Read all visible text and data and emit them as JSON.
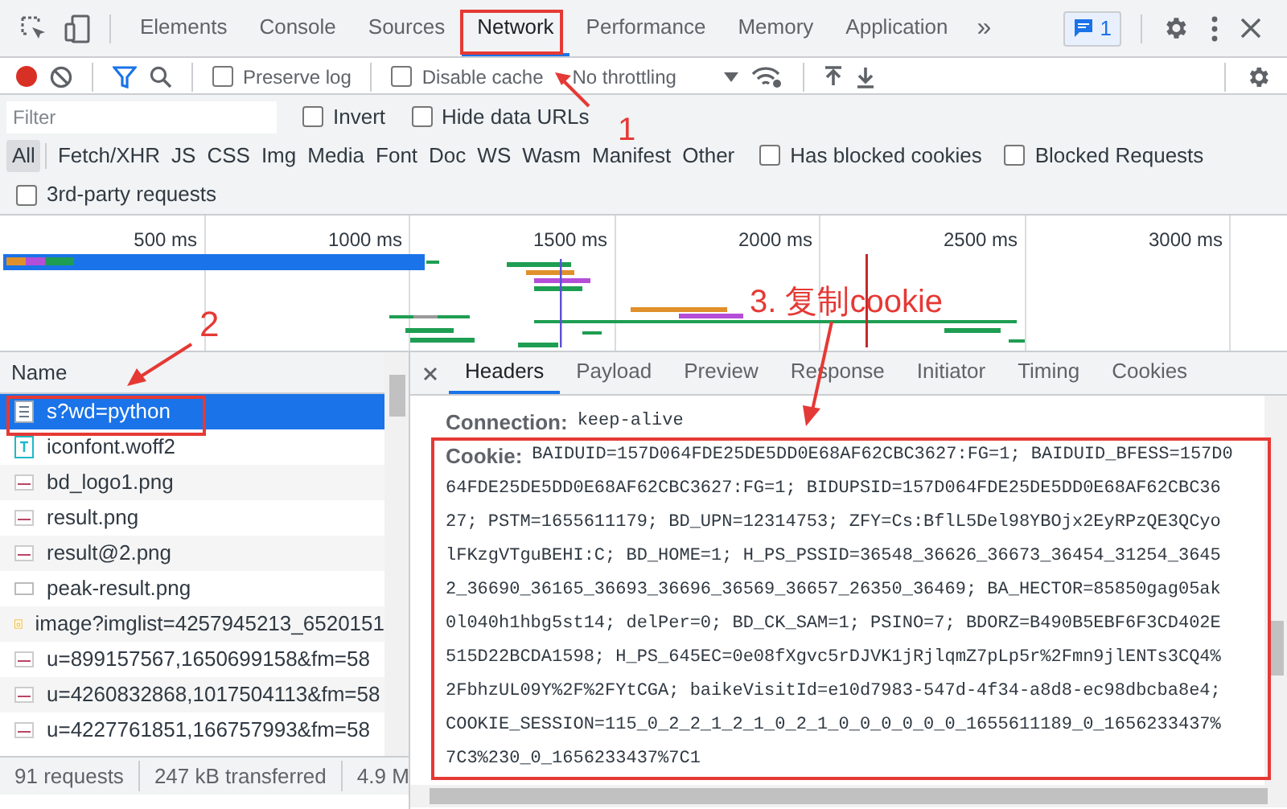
{
  "top_tabs": [
    {
      "label": "Elements",
      "selected": false
    },
    {
      "label": "Console",
      "selected": false
    },
    {
      "label": "Sources",
      "selected": false
    },
    {
      "label": "Network",
      "selected": true
    },
    {
      "label": "Performance",
      "selected": false
    },
    {
      "label": "Memory",
      "selected": false
    },
    {
      "label": "Application",
      "selected": false
    }
  ],
  "more_tabs": "»",
  "message_count": "1",
  "toolbar": {
    "recording": true,
    "checkboxes": [
      {
        "label": "Preserve log",
        "checked": false
      },
      {
        "label": "Disable cache",
        "checked": false
      }
    ],
    "throttling": "No throttling"
  },
  "filter": {
    "placeholder": "Filter",
    "checkboxes": [
      {
        "label": "Invert",
        "checked": false
      },
      {
        "label": "Hide data URLs",
        "checked": false
      }
    ]
  },
  "type_filters": [
    {
      "label": "All",
      "selected": true
    },
    {
      "label": "Fetch/XHR",
      "selected": false
    },
    {
      "label": "JS",
      "selected": false
    },
    {
      "label": "CSS",
      "selected": false
    },
    {
      "label": "Img",
      "selected": false
    },
    {
      "label": "Media",
      "selected": false
    },
    {
      "label": "Font",
      "selected": false
    },
    {
      "label": "Doc",
      "selected": false
    },
    {
      "label": "WS",
      "selected": false
    },
    {
      "label": "Wasm",
      "selected": false
    },
    {
      "label": "Manifest",
      "selected": false
    },
    {
      "label": "Other",
      "selected": false
    }
  ],
  "extra_checkboxes": [
    {
      "label": "Has blocked cookies",
      "checked": false
    },
    {
      "label": "Blocked Requests",
      "checked": false
    },
    {
      "label": "3rd-party requests",
      "checked": false
    }
  ],
  "timeline": {
    "ticks": [
      "500 ms",
      "1000 ms",
      "1500 ms",
      "2000 ms",
      "2500 ms",
      "3000 ms"
    ]
  },
  "requests": {
    "column": "Name",
    "rows": [
      {
        "name": "s?wd=python",
        "kind": "document",
        "selected": true
      },
      {
        "name": "iconfont.woff2",
        "kind": "font",
        "selected": false
      },
      {
        "name": "bd_logo1.png",
        "kind": "image",
        "selected": false
      },
      {
        "name": "result.png",
        "kind": "image",
        "selected": false
      },
      {
        "name": "result@2.png",
        "kind": "image",
        "selected": false
      },
      {
        "name": "peak-result.png",
        "kind": "blank",
        "selected": false
      },
      {
        "name": "image?imglist=4257945213_6520151",
        "kind": "script",
        "selected": false
      },
      {
        "name": "u=899157567,1650699158&fm=58",
        "kind": "image",
        "selected": false
      },
      {
        "name": "u=4260832868,1017504113&fm=58",
        "kind": "image",
        "selected": false
      },
      {
        "name": "u=4227761851,166757993&fm=58",
        "kind": "image",
        "selected": false
      }
    ]
  },
  "status_bar": [
    "91 requests",
    "247 kB transferred",
    "4.9 M"
  ],
  "detail_tabs": [
    {
      "label": "Headers",
      "selected": true
    },
    {
      "label": "Payload",
      "selected": false
    },
    {
      "label": "Preview",
      "selected": false
    },
    {
      "label": "Response",
      "selected": false
    },
    {
      "label": "Initiator",
      "selected": false
    },
    {
      "label": "Timing",
      "selected": false
    },
    {
      "label": "Cookies",
      "selected": false
    }
  ],
  "headers": [
    {
      "name": "Connection:",
      "lines": [
        "keep-alive"
      ]
    },
    {
      "name": "Cookie:",
      "lines": [
        "BAIDUID=157D064FDE25DE5DD0E68AF62CBC3627:FG=1; BAIDUID_BFESS=157D0",
        "64FDE25DE5DD0E68AF62CBC3627:FG=1; BIDUPSID=157D064FDE25DE5DD0E68AF62CBC36",
        "27; PSTM=1655611179; BD_UPN=12314753; ZFY=Cs:BflL5Del98YBOjx2EyRPzQE3QCyo",
        "lFKzgVTguBEHI:C; BD_HOME=1; H_PS_PSSID=36548_36626_36673_36454_31254_3645",
        "2_36690_36165_36693_36696_36569_36657_26350_36469; BA_HECTOR=85850gag05ak",
        "0l040h1hbg5st14; delPer=0; BD_CK_SAM=1; PSINO=7; BDORZ=B490B5EBF6F3CD402E",
        "515D22BCDA1598; H_PS_645EC=0e08fXgvc5rDJVK1jRjlqmZ7pLp5r%2Fmn9jlENTs3CQ4%",
        "2FbhzUL09Y%2F%2FYtCGA; baikeVisitId=e10d7983-547d-4f34-a8d8-ec98dbcba8e4;",
        "COOKIE_SESSION=115_0_2_2_1_2_1_0_2_1_0_0_0_0_0_0_1655611189_0_1656233437%",
        "7C3%230_0_1656233437%7C1"
      ]
    }
  ],
  "annotations": [
    "1",
    "2",
    "3. 复制cookie"
  ]
}
